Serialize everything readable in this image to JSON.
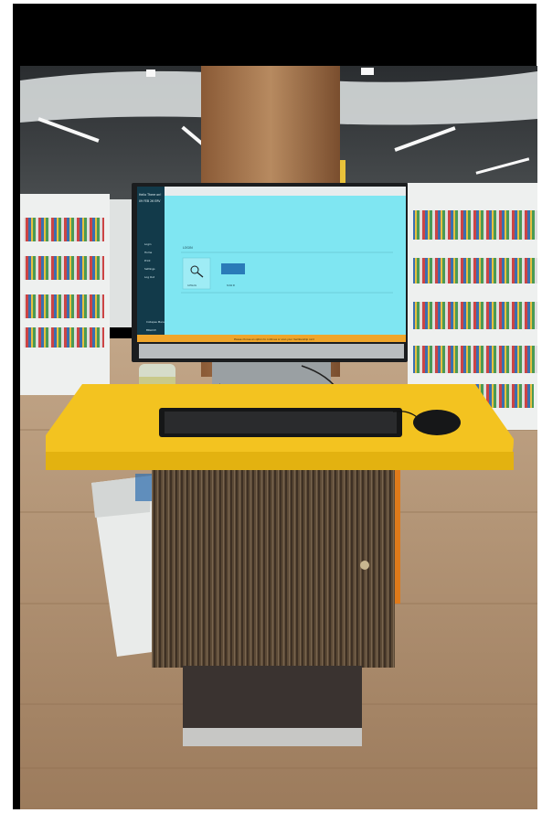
{
  "screen": {
    "sidebar_greeting": "Hello There on!",
    "sidebar_date": "09 FEB 26 ERV",
    "menu_items": [
      "Login",
      "Home",
      "Print",
      "Settings",
      "Log Out"
    ],
    "sidebar_footer": "Collapse Menu",
    "sidebar_footer_sub": "ENGLISH",
    "main_heading": "LOGIN",
    "tile_left_label": "CATALOG",
    "tile_right_label": "SCAN ID",
    "bottom_bar_text": "Please choose an option to continue or scan your membership card"
  },
  "colors": {
    "screen_bg": "#7fe6f2",
    "sidebar": "#123a4a",
    "desk": "#f3c320",
    "cabinet": "#5a4a38",
    "floor": "#b08f6e",
    "shelves": "#eef0ef"
  },
  "icons": [
    "search-icon",
    "mouse-icon",
    "keyboard-icon"
  ]
}
